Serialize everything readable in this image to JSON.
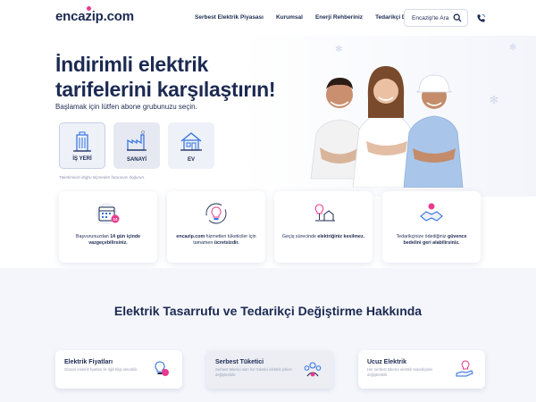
{
  "header": {
    "logo": "encazip.com",
    "nav": [
      "Serbest Elektrik Piyasası",
      "Kurumsal",
      "Enerji Rehberiniz",
      "Tedarikçi Değiştirme"
    ],
    "search_placeholder": "Encazip'te Ara"
  },
  "hero": {
    "title": "İndirimli elektrik tarifelerini karşılaştırın!",
    "subtitle": "Başlamak için lütfen abone grubunuzu seçin.",
    "segments": [
      {
        "label": "İŞ YERİ",
        "icon": "office-building-icon"
      },
      {
        "label": "SANAYİ",
        "icon": "factory-icon"
      },
      {
        "label": "EV",
        "icon": "house-icon"
      }
    ],
    "note": "Tüketiminizi doğru ölçmeden faturanızı doğurun."
  },
  "features": [
    {
      "pre": "Başvurunuzdan ",
      "bold": "14 gün içinde vazgeçebilirsiniz.",
      "post": "",
      "icon": "calendar-icon",
      "badge": "14"
    },
    {
      "pre": "",
      "bold": "encazip.com",
      "post": " hizmetleri tüketiciler için tamamen ",
      "bold2": "ücretsizdir.",
      "icon": "lightbulb-cycle-icon"
    },
    {
      "pre": "Geçiş sürecinde ",
      "bold": "elektriğiniz kesilmez.",
      "post": "",
      "icon": "bulb-house-icon"
    },
    {
      "pre": "Tedarikçinize ödediğiniz ",
      "bold": "güvence bedelini geri alabilirsiniz.",
      "post": "",
      "icon": "handshake-icon"
    }
  ],
  "section": {
    "title": "Elektrik Tasarrufu ve Tedarikçi Değiştirme Hakkında",
    "cards": [
      {
        "title": "Elektrik Fiyatları",
        "desc": "Güncel elektrik fiyatları ile ilgili bilgi alınabilir.",
        "icon": "bulb-price-icon"
      },
      {
        "title": "Serbest Tüketici",
        "desc": "Serbest tüketici olan her tüketici elektrik şirketi değiştirebilir.",
        "icon": "people-icon"
      },
      {
        "title": "Ucuz Elektrik",
        "desc": "Her serbest tüketici elektrik tedarikçisini değiştirebilir.",
        "icon": "hand-bulb-icon"
      }
    ]
  },
  "colors": {
    "navy": "#1c2a52",
    "accent": "#2f6fe0",
    "pink": "#e83a8c"
  }
}
